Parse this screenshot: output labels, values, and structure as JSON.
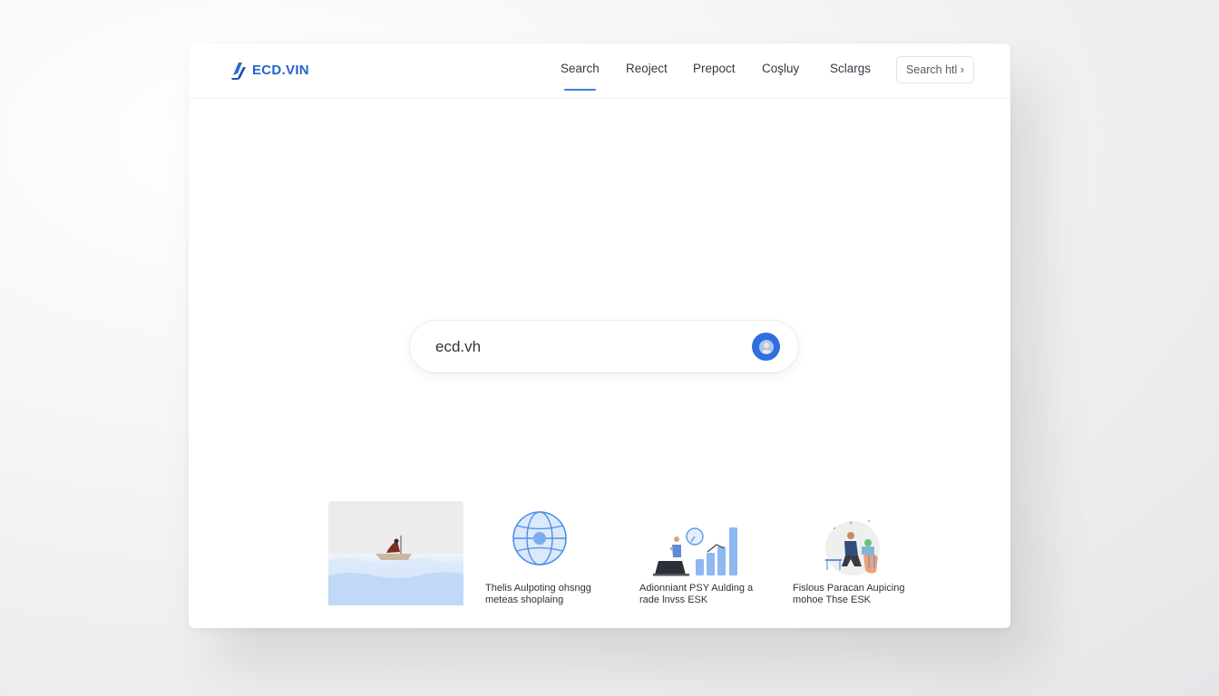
{
  "header": {
    "logo_text": "ECD.VIN",
    "nav": [
      {
        "label": "Search",
        "active": true
      },
      {
        "label": "Reoject",
        "active": false
      },
      {
        "label": "Prepoct",
        "active": false
      },
      {
        "label": "Coşluy",
        "active": false
      },
      {
        "label": "Sclargs",
        "active": false
      }
    ],
    "search_button": "Search htl ›"
  },
  "search": {
    "value": "ecd.vh",
    "button_icon": "user-search-icon"
  },
  "tiles": [
    {
      "caption_line1": "",
      "caption_line2": "",
      "icon": "boat-on-water-illustration"
    },
    {
      "caption_line1": "Thelis Aulpoting ohsngg",
      "caption_line2": "meteas shoplaing",
      "icon": "globe-icon"
    },
    {
      "caption_line1": "Adionniant PSY Aulding a",
      "caption_line2": "rade lnvss ESK",
      "icon": "analytics-illustration"
    },
    {
      "caption_line1": "Fislous Paracan Aupicing",
      "caption_line2": "mohoe Thse ESK",
      "icon": "person-working-illustration"
    }
  ],
  "colors": {
    "accent": "#3b7be8",
    "logo": "#2563c9",
    "search_button": "#2f6fde"
  }
}
